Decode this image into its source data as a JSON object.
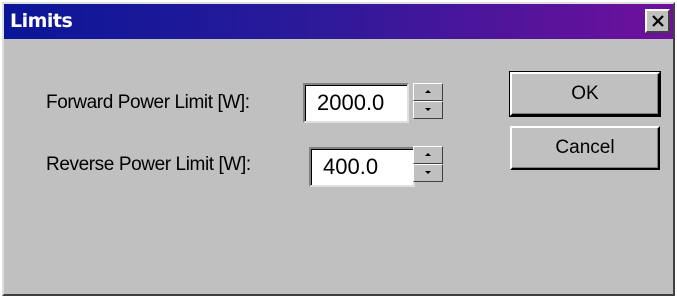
{
  "window": {
    "title": "Limits"
  },
  "fields": {
    "forward": {
      "label": "Forward Power Limit [W]:",
      "value": "2000.0"
    },
    "reverse": {
      "label": "Reverse Power Limit [W]:",
      "value": "400.0"
    }
  },
  "buttons": {
    "ok": "OK",
    "cancel": "Cancel"
  },
  "icons": {
    "close": "close-icon",
    "spin_up": "arrow-up-icon",
    "spin_down": "arrow-down-icon"
  }
}
